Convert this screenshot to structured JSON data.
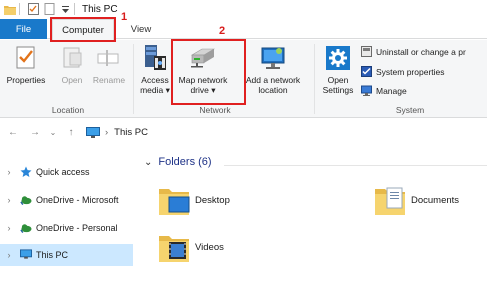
{
  "window": {
    "title": "This PC"
  },
  "tabs": {
    "file": "File",
    "computer": "Computer",
    "view": "View"
  },
  "annotations": {
    "one": "1",
    "two": "2"
  },
  "ribbon": {
    "location": {
      "label": "Location",
      "properties": "Properties",
      "open": "Open",
      "rename": "Rename"
    },
    "network": {
      "label": "Network",
      "access_media_1": "Access",
      "access_media_2": "media",
      "map_drive_1": "Map network",
      "map_drive_2": "drive",
      "add_location_1": "Add a network",
      "add_location_2": "location"
    },
    "system": {
      "label": "System",
      "open_settings_1": "Open",
      "open_settings_2": "Settings",
      "uninstall": "Uninstall or change a pr",
      "system_properties": "System properties",
      "manage": "Manage"
    }
  },
  "address": {
    "path": "This PC"
  },
  "nav": {
    "items": [
      {
        "label": "Quick access"
      },
      {
        "label": "OneDrive - Microsoft"
      },
      {
        "label": "OneDrive - Personal"
      },
      {
        "label": "This PC"
      }
    ]
  },
  "content": {
    "section": "Folders (6)",
    "folders": [
      {
        "label": "Desktop"
      },
      {
        "label": "Documents"
      },
      {
        "label": "Videos"
      }
    ]
  },
  "colors": {
    "accent": "#1979ca",
    "annotation": "#e02020",
    "selected": "#cce8ff"
  }
}
